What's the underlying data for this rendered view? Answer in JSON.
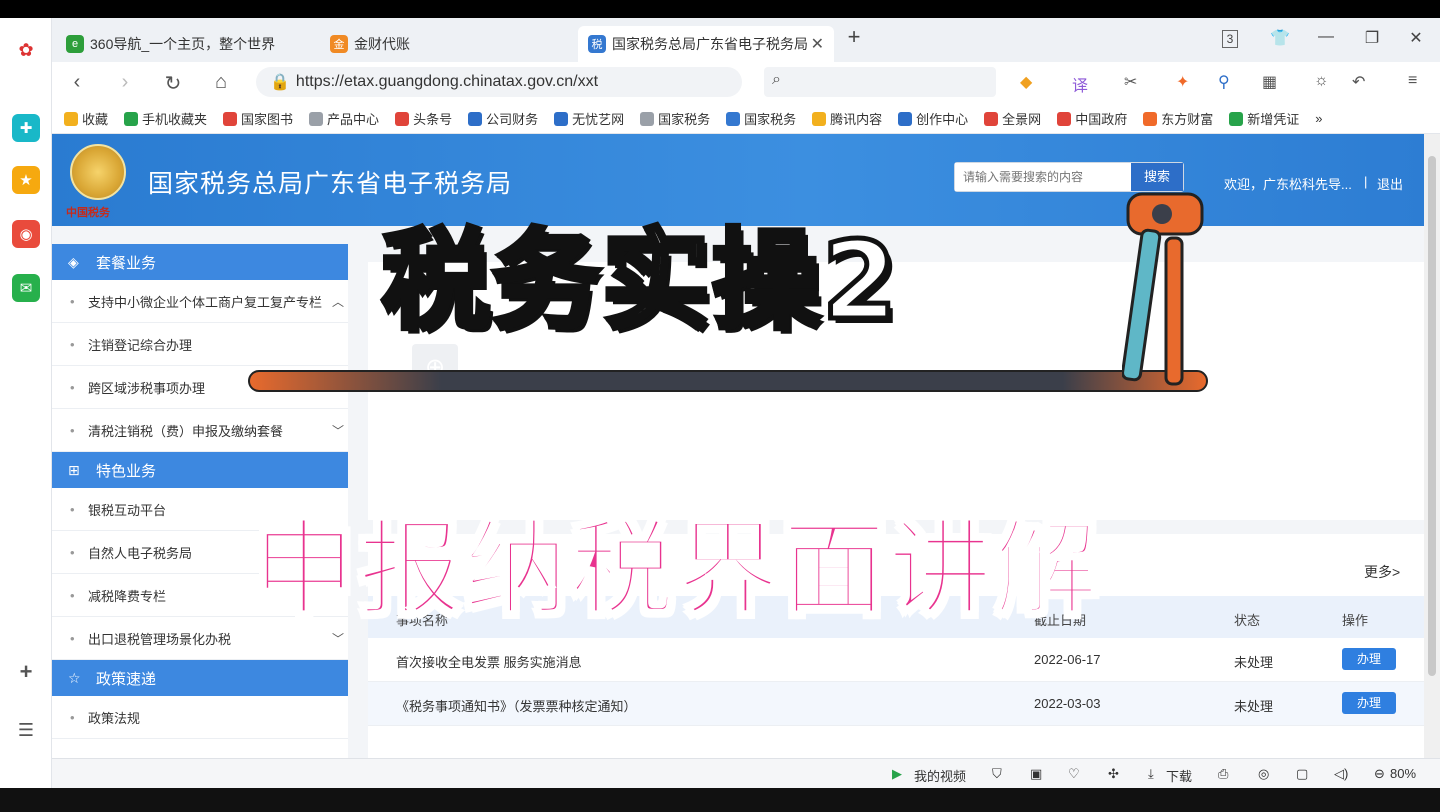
{
  "browser": {
    "tabs": [
      {
        "label": "360导航_一个主页，整个世界",
        "active": false
      },
      {
        "label": "金财代账",
        "active": false
      },
      {
        "label": "国家税务总局广东省电子税务局",
        "active": true
      }
    ],
    "tab_count_badge": "3",
    "url": "https://etax.guangdong.chinatax.gov.cn/xxt",
    "bookmarks": [
      "收藏",
      "手机收藏夹",
      "国家图书",
      "产品中心",
      "头条号",
      "公司财务",
      "无忧艺网",
      "国家税务",
      "国家税务",
      "腾讯内容",
      "创作中心",
      "全景网",
      "中国政府",
      "东方财富",
      "新增凭证"
    ],
    "more_bookmarks": "»",
    "status_bar": {
      "video_label": "我的视频",
      "download_label": "下载",
      "zoom": "80%"
    }
  },
  "site": {
    "title": "国家税务总局广东省电子税务局",
    "emblem_caption": "中国税务",
    "search_placeholder": "请输入需要搜索的内容",
    "search_button": "搜索",
    "welcome": "欢迎，广东松科先导...",
    "logout": "退出"
  },
  "sidebar": {
    "sections": [
      {
        "title": "套餐业务",
        "items": [
          "支持中小微企业个体工商户复工复产专栏",
          "注销登记综合办理",
          "跨区域涉税事项办理",
          "清税注销税（费）申报及缴纳套餐"
        ]
      },
      {
        "title": "特色业务",
        "items": [
          "银税互动平台",
          "自然人电子税务局",
          "减税降费专栏",
          "出口退税管理场景化办税"
        ]
      },
      {
        "title": "政策速递",
        "items": [
          "政策法规"
        ]
      }
    ]
  },
  "main": {
    "more_link": "更多>",
    "list_headers": {
      "name": "事项名称",
      "deadline": "截止日期",
      "status": "状态",
      "action": "操作"
    },
    "rows": [
      {
        "name": "首次接收全电发票 服务实施消息",
        "deadline": "2022-06-17",
        "status": "未处理",
        "action": "办理"
      },
      {
        "name": "《税务事项通知书》（发票票种核定通知）",
        "deadline": "2022-03-03",
        "status": "未处理",
        "action": "办理"
      }
    ]
  },
  "overlay": {
    "title": "税务实操2",
    "subtitle": "申报纳税界面讲解"
  },
  "colors": {
    "banner": "#3c8fe0",
    "section_head": "#3d88e0",
    "button": "#2f7fe0",
    "overlay_pink": "#e8338f"
  }
}
